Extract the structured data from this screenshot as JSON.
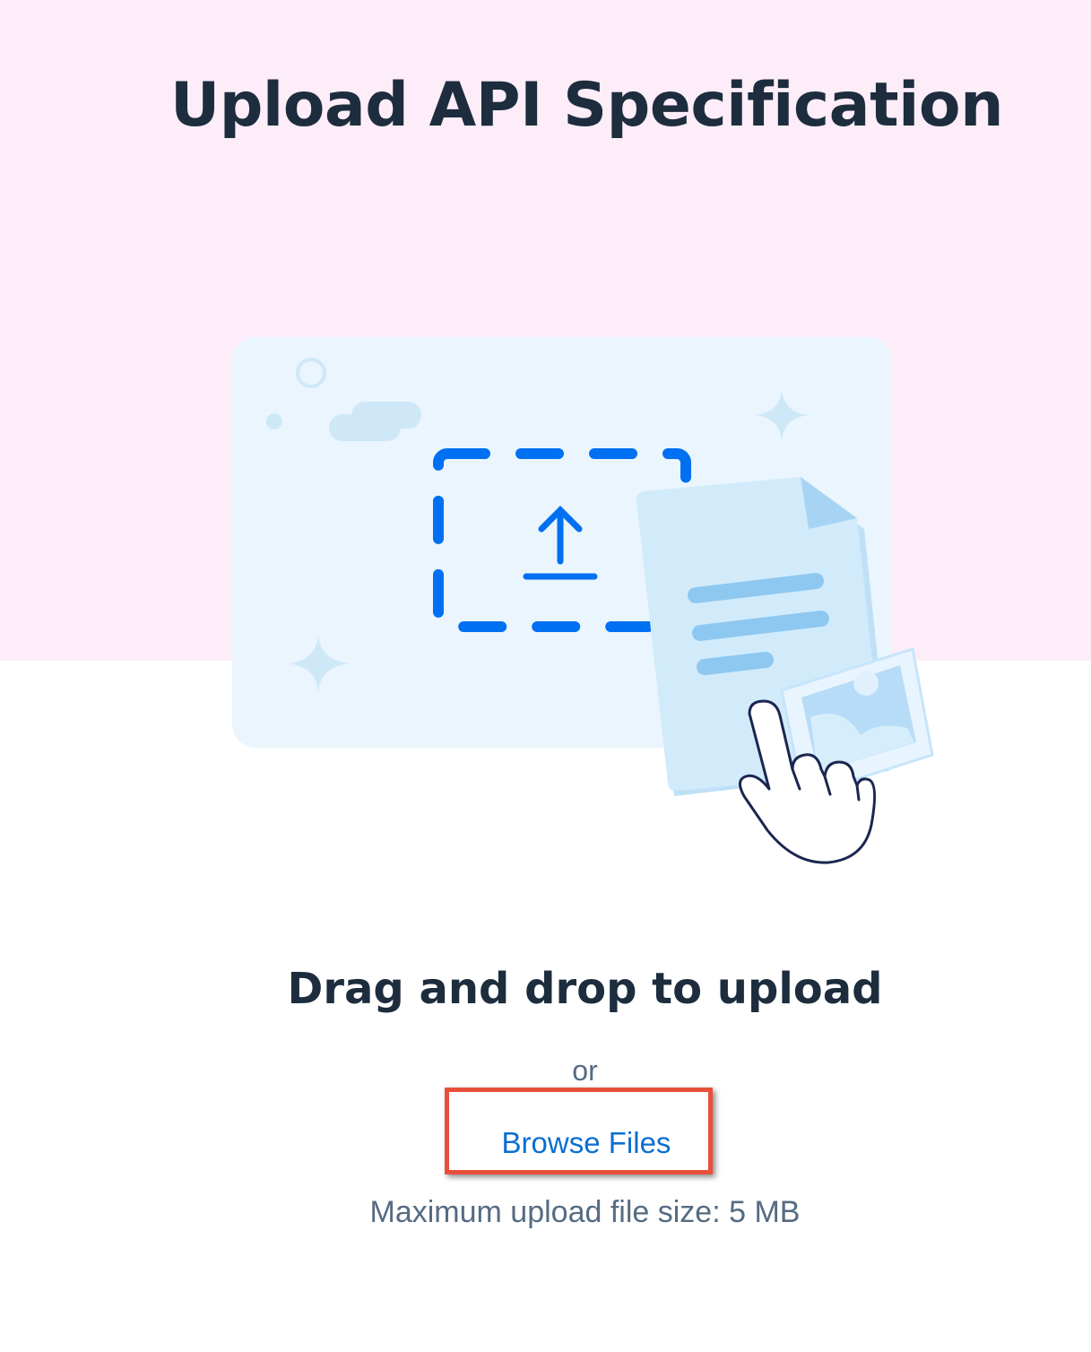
{
  "page": {
    "title": "Upload API Specification"
  },
  "upload_area": {
    "heading": "Drag and drop to upload",
    "separator": "or",
    "browse_label": "Browse Files",
    "size_hint": "Maximum upload file size: 5 MB"
  },
  "illustration": {
    "icons": [
      "upload-arrow-icon",
      "document-icon",
      "image-icon",
      "pointing-hand-icon",
      "sparkle-icon",
      "cloud-icon"
    ]
  },
  "colors": {
    "header_background": "#fdedf8",
    "text_primary": "#1d2d3e",
    "text_secondary": "#556b82",
    "link": "#0a6ed1",
    "highlight": "#e8503c"
  }
}
